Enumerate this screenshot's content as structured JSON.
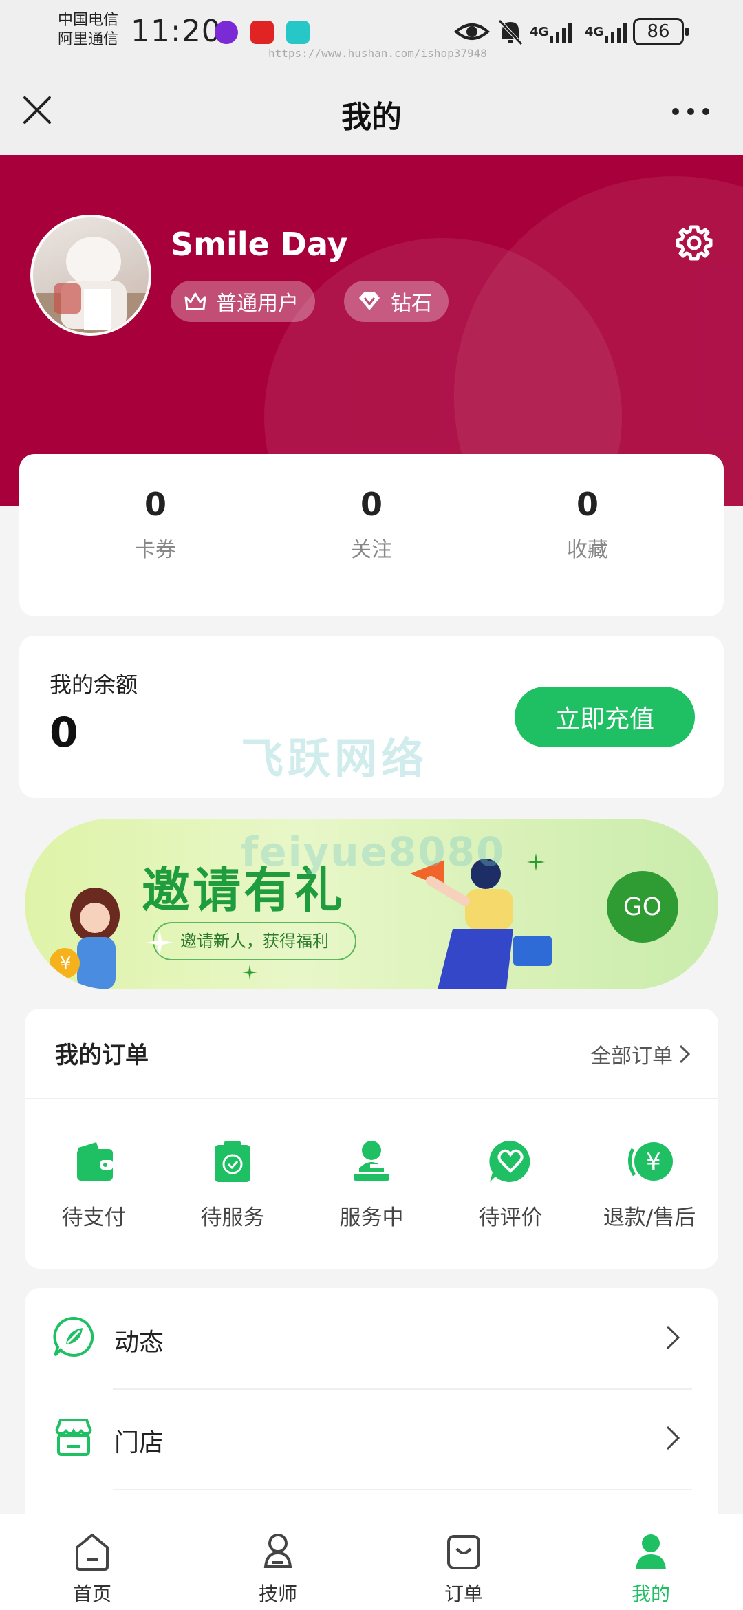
{
  "status_bar": {
    "carrier_1": "中国电信",
    "carrier_2": "阿里通信",
    "time": "11:20",
    "network_1": "4G",
    "network_2": "4G",
    "battery": "86",
    "watermark_url": "https://www.hushan.com/ishop37948"
  },
  "nav": {
    "title": "我的"
  },
  "profile": {
    "username": "Smile Day",
    "badge_user": "普通用户",
    "badge_level": "钻石",
    "header_color": "#a8003a"
  },
  "stats": [
    {
      "value": "0",
      "label": "卡券"
    },
    {
      "value": "0",
      "label": "关注"
    },
    {
      "value": "0",
      "label": "收藏"
    }
  ],
  "balance": {
    "label": "我的余额",
    "value": "0",
    "button": "立即充值",
    "button_color": "#1fbf63"
  },
  "watermark": {
    "text_1": "飞跃网络",
    "text_2": "feiyue8080"
  },
  "invite": {
    "title": "邀请有礼",
    "subtitle": "邀请新人，获得福利",
    "go": "GO"
  },
  "orders": {
    "title": "我的订单",
    "all_link": "全部订单",
    "items": [
      {
        "label": "待支付",
        "icon": "wallet-icon"
      },
      {
        "label": "待服务",
        "icon": "clipboard-check-icon"
      },
      {
        "label": "服务中",
        "icon": "person-stamp-icon"
      },
      {
        "label": "待评价",
        "icon": "heart-chat-icon"
      },
      {
        "label": "退款/售后",
        "icon": "yuan-refund-icon"
      }
    ]
  },
  "menu": [
    {
      "label": "动态",
      "icon": "compass-leaf-icon"
    },
    {
      "label": "门店",
      "icon": "store-icon"
    }
  ],
  "tabs": [
    {
      "label": "首页",
      "icon": "home-icon"
    },
    {
      "label": "技师",
      "icon": "technician-icon"
    },
    {
      "label": "订单",
      "icon": "order-bag-icon"
    },
    {
      "label": "我的",
      "icon": "profile-icon",
      "active": true
    }
  ]
}
